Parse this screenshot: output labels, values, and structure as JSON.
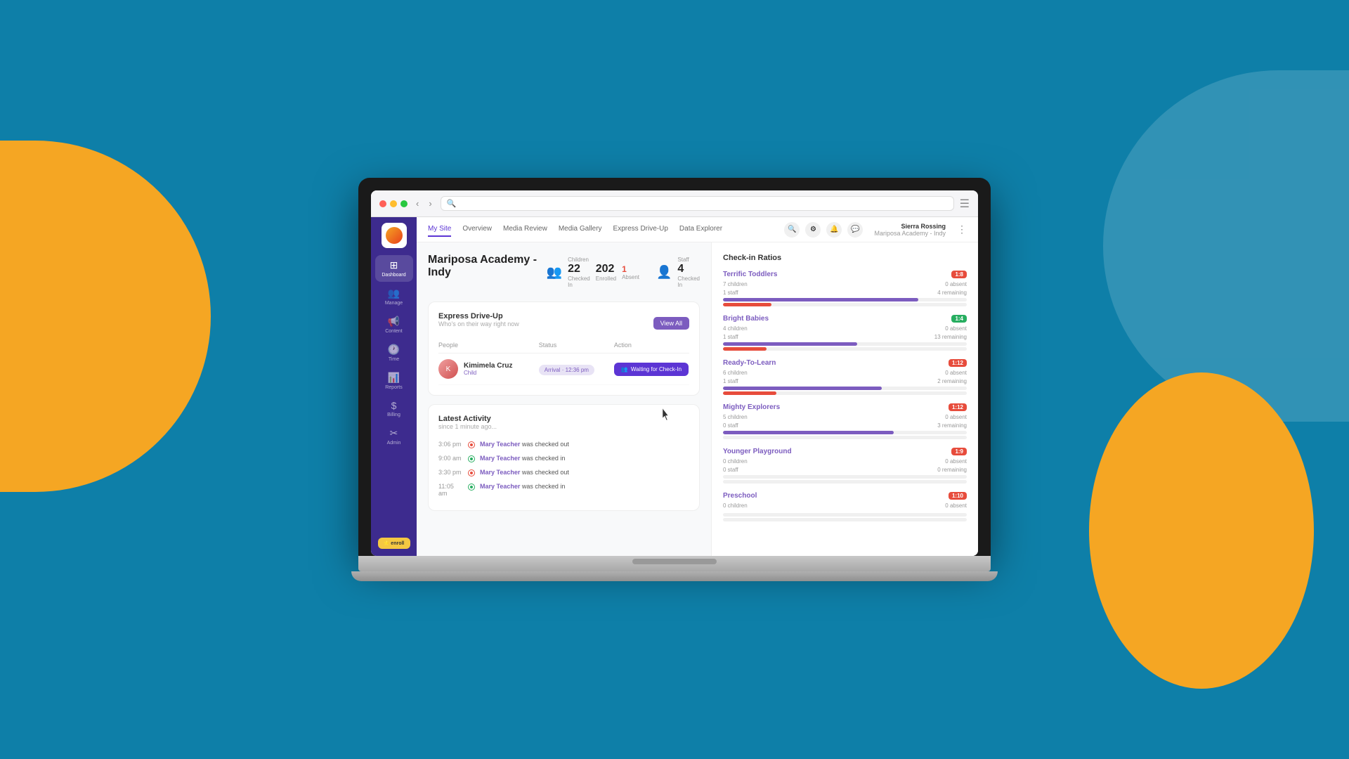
{
  "background": {
    "main_color": "#0e7fa8"
  },
  "browser": {
    "search_placeholder": "Search",
    "menu_icon": "☰"
  },
  "nav": {
    "links": [
      {
        "label": "My Site",
        "active": false
      },
      {
        "label": "Overview",
        "active": false
      },
      {
        "label": "Media Review",
        "active": false
      },
      {
        "label": "Media Gallery",
        "active": false
      },
      {
        "label": "Express Drive-Up",
        "active": false
      },
      {
        "label": "Data Explorer",
        "active": false
      }
    ],
    "user": {
      "name": "Sierra Rossing",
      "location": "Mariposa Academy - Indy"
    }
  },
  "sidebar": {
    "items": [
      {
        "label": "Dashboard",
        "icon": "⊞",
        "active": true
      },
      {
        "label": "Manage",
        "icon": "👥",
        "active": false
      },
      {
        "label": "Content",
        "icon": "📢",
        "active": false
      },
      {
        "label": "Time",
        "icon": "🕐",
        "active": false
      },
      {
        "label": "Reports",
        "icon": "📊",
        "active": false
      },
      {
        "label": "Billing",
        "icon": "$",
        "active": false
      },
      {
        "label": "Admin",
        "icon": "✂",
        "active": false
      }
    ],
    "enroll_label": "enroll"
  },
  "page": {
    "title": "Mariposa Academy - Indy"
  },
  "stats": {
    "children_label": "Children",
    "checked_in": "22",
    "checked_in_label": "Checked In",
    "enrolled": "202",
    "enrolled_label": "Enrolled",
    "absent": "1",
    "absent_label": "Absent",
    "staff_label": "Staff",
    "staff_checked_in": "4",
    "staff_checked_in_label": "Checked In"
  },
  "express_drive_up": {
    "title": "Express Drive-Up",
    "subtitle": "Who's on their way right now",
    "view_all_label": "View All",
    "columns": [
      "People",
      "Status",
      "Action"
    ],
    "row": {
      "name": "Kimimela Cruz",
      "role": "Child",
      "status": "Arrival · 12:36 pm",
      "action": "Waiting for Check-In"
    }
  },
  "latest_activity": {
    "title": "Latest Activity",
    "subtitle": "since 1 minute ago...",
    "items": [
      {
        "time": "3:06 pm",
        "person": "Mary Teacher",
        "action": "was checked out",
        "type": "out"
      },
      {
        "time": "9:00 am",
        "person": "Mary Teacher",
        "action": "was checked in",
        "type": "in"
      },
      {
        "time": "3:30 pm",
        "person": "Mary Teacher",
        "action": "was checked out",
        "type": "out"
      },
      {
        "time": "11:05 am",
        "person": "Mary Teacher",
        "action": "was checked in",
        "type": "in"
      }
    ]
  },
  "check_in_ratios": {
    "title": "Check-in Ratios",
    "rooms": [
      {
        "name": "Terrific Toddlers",
        "badge": "1:8",
        "badge_color": "red",
        "children": "7 children",
        "staff": "1 staff",
        "absent": "0 absent",
        "remaining": "4 remaining",
        "children_bar": 80,
        "staff_bar": 20
      },
      {
        "name": "Bright Babies",
        "badge": "1:4",
        "badge_color": "green",
        "children": "4 children",
        "staff": "1 staff",
        "absent": "0 absent",
        "remaining": "13 remaining",
        "children_bar": 55,
        "staff_bar": 18
      },
      {
        "name": "Ready-To-Learn",
        "badge": "1:12",
        "badge_color": "red",
        "children": "6 children",
        "staff": "1 staff",
        "absent": "0 absent",
        "remaining": "2 remaining",
        "children_bar": 65,
        "staff_bar": 22
      },
      {
        "name": "Mighty Explorers",
        "badge": "1:12",
        "badge_color": "red",
        "children": "5 children",
        "staff": "0 staff",
        "absent": "0 absent",
        "remaining": "3 remaining",
        "children_bar": 70,
        "staff_bar": 0
      },
      {
        "name": "Younger Playground",
        "badge": "1:9",
        "badge_color": "red",
        "children": "0 children",
        "staff": "0 staff",
        "absent": "0 absent",
        "remaining": "0 remaining",
        "children_bar": 0,
        "staff_bar": 0
      },
      {
        "name": "Preschool",
        "badge": "1:10",
        "badge_color": "red",
        "children": "0 children",
        "staff": "",
        "absent": "0 absent",
        "remaining": "",
        "children_bar": 0,
        "staff_bar": 0
      }
    ]
  }
}
